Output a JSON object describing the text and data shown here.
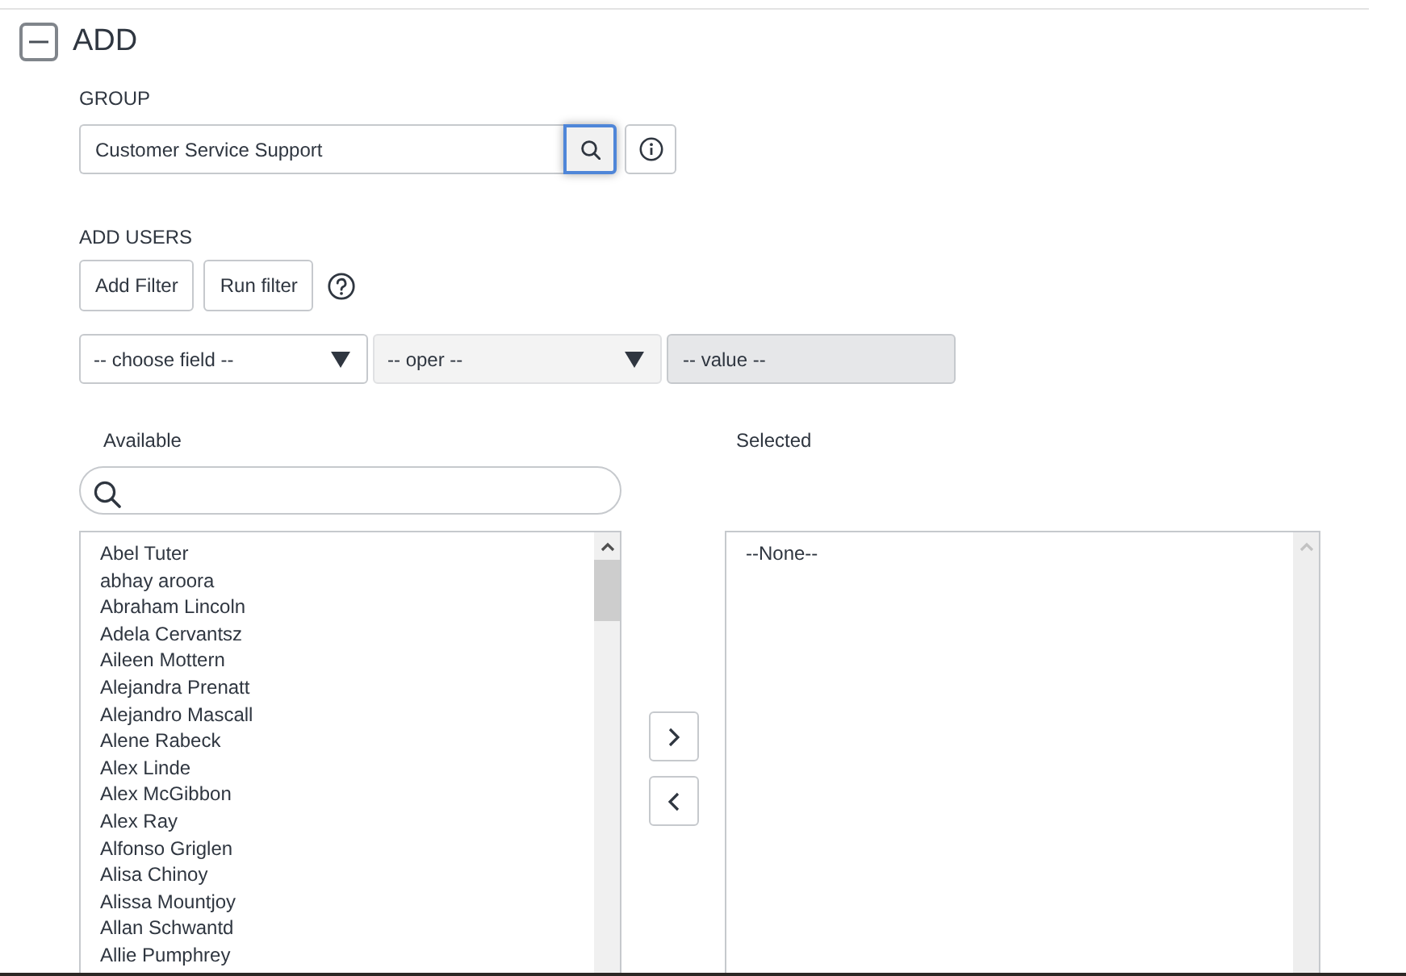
{
  "section": {
    "title": "ADD",
    "expanded": true
  },
  "group": {
    "label": "GROUP",
    "field": {
      "value": "Customer Service Support"
    },
    "lookup_button": {
      "focused": true
    }
  },
  "add_users": {
    "label": "ADD USERS",
    "buttons": [
      "Add Filter",
      "Run filter"
    ]
  },
  "filter": {
    "field_select": {
      "value": "-- choose field --",
      "disabled": false
    },
    "operator_select": {
      "value": "-- oper --",
      "disabled": true
    },
    "value_field": {
      "value": "-- value --",
      "disabled": true
    }
  },
  "available": {
    "label": "Available",
    "items": [
      {
        "label": "Abel Tuter",
        "selected": false
      },
      {
        "label": "abhay aroora",
        "selected": false
      },
      {
        "label": "Abraham Lincoln",
        "selected": false
      },
      {
        "label": "Adela Cervantsz",
        "selected": false
      },
      {
        "label": "Aileen Mottern",
        "selected": false
      },
      {
        "label": "Alejandra Prenatt",
        "selected": false
      },
      {
        "label": "Alejandro Mascall",
        "selected": false
      },
      {
        "label": "Alene Rabeck",
        "selected": false
      },
      {
        "label": "Alex Linde",
        "selected": false
      },
      {
        "label": "Alex McGibbon",
        "selected": false
      },
      {
        "label": "Alex Ray",
        "selected": false
      },
      {
        "label": "Alfonso Griglen",
        "selected": false
      },
      {
        "label": "Alisa Chinoy",
        "selected": false
      },
      {
        "label": "Alissa Mountjoy",
        "selected": false
      },
      {
        "label": "Allan Schwantd",
        "selected": false
      },
      {
        "label": "Allie Pumphrey",
        "selected": false
      }
    ]
  },
  "selected": {
    "label": "Selected",
    "items": [
      {
        "label": "--None--",
        "selected": false
      }
    ]
  }
}
